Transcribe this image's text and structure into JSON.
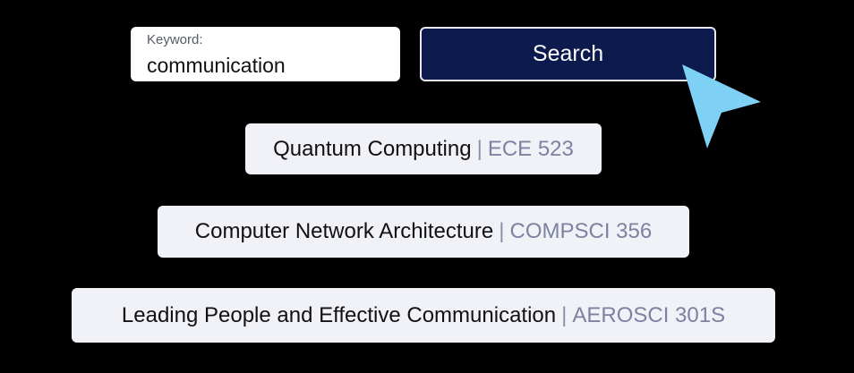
{
  "search": {
    "keyword_label": "Keyword:",
    "keyword_value": "communication",
    "button_label": "Search"
  },
  "results": [
    {
      "title": "Quantum Computing",
      "separator": "|",
      "code": "ECE 523"
    },
    {
      "title": "Computer Network Architecture",
      "separator": "|",
      "code": "COMPSCI 356"
    },
    {
      "title": "Leading People and Effective Communication",
      "separator": "|",
      "code": "AEROSCI 301S"
    }
  ],
  "colors": {
    "background": "#000000",
    "button_bg": "#0c1a4d",
    "result_bg": "#f1f2f8",
    "course_code": "#7d82a0",
    "cursor": "#7fd0f5"
  },
  "icons": {
    "cursor": "pointer-arrow-icon"
  }
}
